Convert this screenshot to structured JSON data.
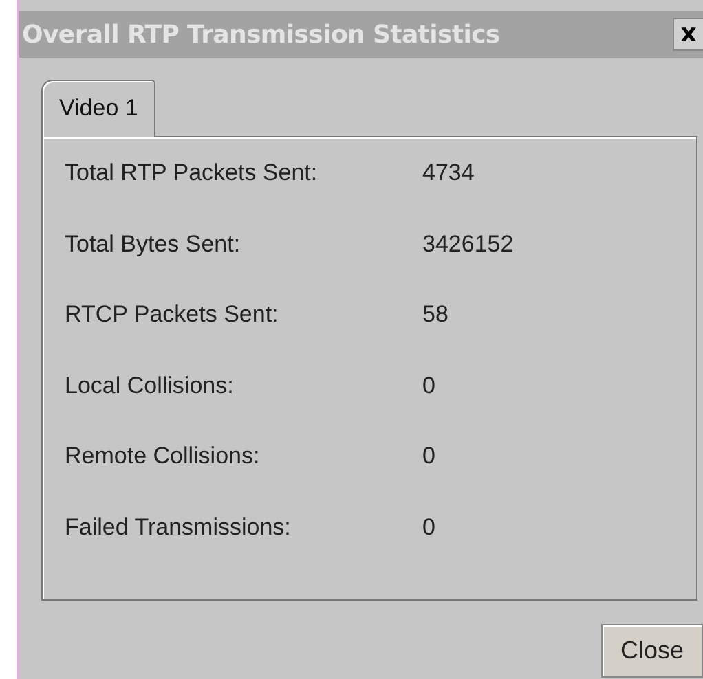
{
  "window": {
    "title": "Overall RTP Transmission Statistics",
    "close_glyph": "x"
  },
  "tabs": [
    {
      "label": "Video 1",
      "selected": true
    }
  ],
  "stats": [
    {
      "label": "Total RTP Packets Sent:",
      "value": "4734"
    },
    {
      "label": "Total Bytes Sent:",
      "value": "3426152"
    },
    {
      "label": "RTCP Packets Sent:",
      "value": "58"
    },
    {
      "label": "Local Collisions:",
      "value": "0"
    },
    {
      "label": "Remote Collisions:",
      "value": "0"
    },
    {
      "label": "Failed Transmissions:",
      "value": "0"
    }
  ],
  "buttons": [
    "Close"
  ]
}
